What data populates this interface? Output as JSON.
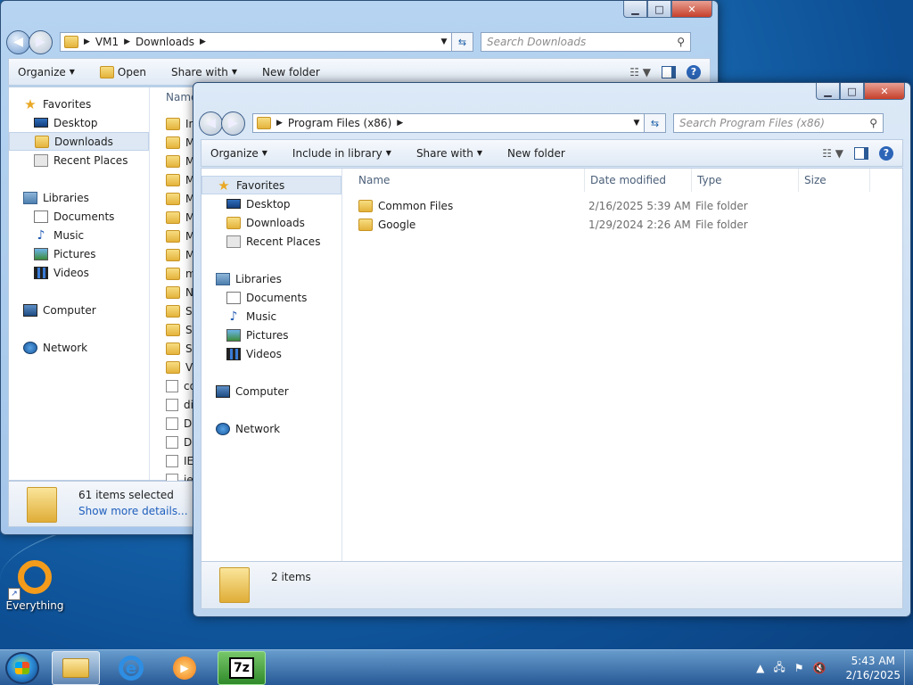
{
  "desktop": {
    "shortcut_label": "Everything"
  },
  "back_window": {
    "breadcrumb": [
      "VM1",
      "Downloads"
    ],
    "search_placeholder": "Search Downloads",
    "toolbar": {
      "organize": "Organize",
      "open": "Open",
      "share_with": "Share with",
      "new_folder": "New folder"
    },
    "nav": {
      "favorites": "Favorites",
      "desktop": "Desktop",
      "downloads": "Downloads",
      "recent_places": "Recent Places",
      "libraries": "Libraries",
      "documents": "Documents",
      "music": "Music",
      "pictures": "Pictures",
      "videos": "Videos",
      "computer": "Computer",
      "network": "Network"
    },
    "column_name": "Name",
    "file_fragments": [
      "In",
      "M",
      "M",
      "M",
      "M",
      "M",
      "M",
      "M",
      "m",
      "N",
      "Sa",
      "Sa",
      "Sa",
      "Vi",
      "co",
      "di",
      "Do",
      "Do",
      "IE",
      "ie"
    ],
    "details": {
      "count": "61 items selected",
      "link": "Show more details..."
    }
  },
  "front_window": {
    "breadcrumb": [
      "Program Files (x86)"
    ],
    "search_placeholder": "Search Program Files (x86)",
    "toolbar": {
      "organize": "Organize",
      "include_in_library": "Include in library",
      "share_with": "Share with",
      "new_folder": "New folder"
    },
    "nav": {
      "favorites": "Favorites",
      "desktop": "Desktop",
      "downloads": "Downloads",
      "recent_places": "Recent Places",
      "libraries": "Libraries",
      "documents": "Documents",
      "music": "Music",
      "pictures": "Pictures",
      "videos": "Videos",
      "computer": "Computer",
      "network": "Network"
    },
    "columns": {
      "name": "Name",
      "date_modified": "Date modified",
      "type": "Type",
      "size": "Size"
    },
    "files": [
      {
        "name": "Common Files",
        "date": "2/16/2025 5:39 AM",
        "type": "File folder"
      },
      {
        "name": "Google",
        "date": "1/29/2024 2:26 AM",
        "type": "File folder"
      }
    ],
    "details": {
      "count": "2 items"
    }
  },
  "taskbar": {
    "time": "5:43 AM",
    "date": "2/16/2025",
    "apps": [
      "windows-explorer",
      "internet-explorer",
      "windows-media-player",
      "7-zip"
    ]
  }
}
